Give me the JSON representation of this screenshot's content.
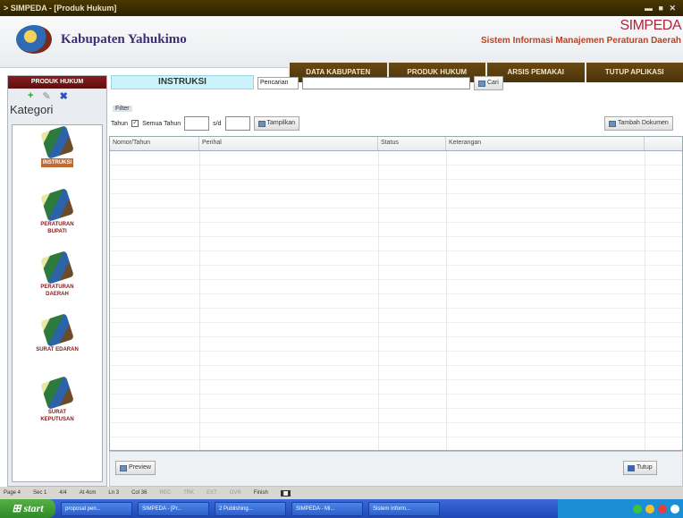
{
  "window": {
    "title": "> SIMPEDA - [Produk Hukum]",
    "controls": "▬ ■ ✕"
  },
  "banner": {
    "regency": "Kabupaten Yahukimo",
    "app_short": "SIMPEDA",
    "app_full": "Sistem Informasi Manajemen Peraturan Daerah"
  },
  "topnav": [
    "DATA KABUPATEN",
    "PRODUK HUKUM",
    "ARSIS PEMAKAI",
    "TUTUP APLIKASI"
  ],
  "sidebar": {
    "header": "PRODUK HUKUM",
    "kategori": "Kategori",
    "categories": [
      "INSTRUKSI",
      "PERATURAN BUPATI",
      "PERATURAN DAERAH",
      "SURAT EDARAN",
      "SURAT KEPUTUSAN"
    ]
  },
  "main": {
    "section": "INSTRUKSI",
    "search_label": "Pencarian",
    "search_value": "",
    "search_button": "Cari",
    "filter_title": "Filter",
    "tahun_label": "Tahun",
    "semua_tahun_label": "Semua Tahun",
    "sd_label": "s/d",
    "tampilkan_button": "Tampilkan",
    "tambah_button": "Tambah Dokumen",
    "columns": [
      "Nomor/Tahun",
      "Perihal",
      "Status",
      "Keterangan"
    ],
    "preview_button": "Preview",
    "tutup_button": "Tutup"
  },
  "statusbar": [
    "Page 4",
    "Sec 1",
    "4/4",
    "At 4cm",
    "Ln 3",
    "Col 36",
    "REC",
    "TRK",
    "EXT",
    "OVR",
    "Finish"
  ],
  "taskbar": {
    "start": "start",
    "tasks": [
      "proposal pen...",
      "SIMPEDA - [Pr...",
      "2 Publishing...",
      "SIMPEDA - Mi...",
      "Sistem Inform..."
    ]
  }
}
